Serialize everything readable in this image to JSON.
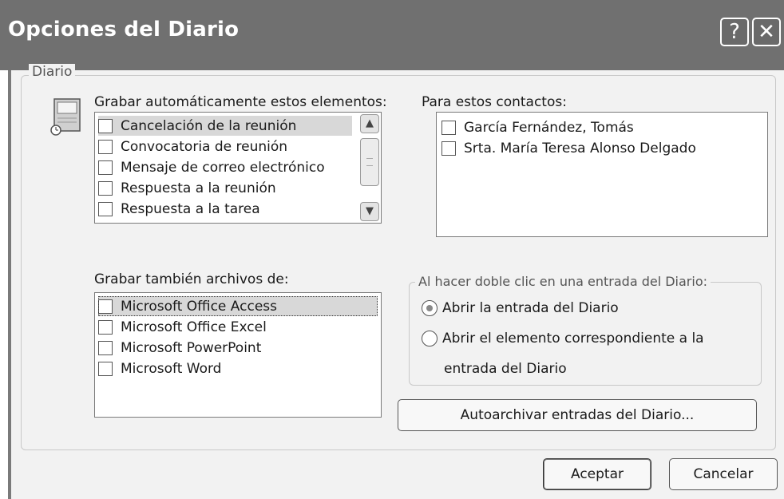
{
  "window": {
    "title": "Opciones del Diario",
    "help_glyph": "?",
    "close_glyph": "✕"
  },
  "group": {
    "label": "Diario"
  },
  "auto_record": {
    "label": "Grabar automáticamente estos elementos:",
    "items": [
      "Cancelación de la reunión",
      "Convocatoria de reunión",
      "Mensaje de correo electrónico",
      "Respuesta a la reunión",
      "Respuesta a la tarea"
    ]
  },
  "contacts": {
    "label": "Para estos contactos:",
    "items": [
      "García Fernández, Tomás",
      "Srta. María Teresa Alonso Delgado"
    ]
  },
  "files": {
    "label": "Grabar también archivos de:",
    "items": [
      "Microsoft Office Access",
      "Microsoft Office Excel",
      "Microsoft PowerPoint",
      "Microsoft Word"
    ]
  },
  "double_click": {
    "label": "Al hacer doble clic en una entrada del Diario:",
    "option1": "Abrir la entrada del Diario",
    "option2_line1": "Abrir el elemento correspondiente a la",
    "option2_line2": "entrada del Diario",
    "selected": 1
  },
  "buttons": {
    "autoarchive": "Autoarchivar entradas del Diario...",
    "ok": "Aceptar",
    "cancel": "Cancelar"
  },
  "colors": {
    "titlebar": "#707070",
    "dialog_bg": "#f2f2f2",
    "selection": "#d8d8d8"
  }
}
